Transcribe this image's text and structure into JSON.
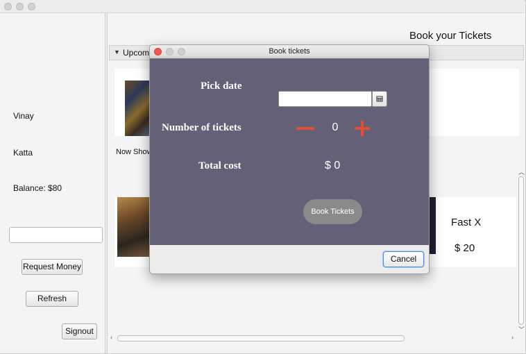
{
  "sidebar": {
    "first_name": "Vinay",
    "last_name": "Katta",
    "balance": "Balance: $80",
    "amount_input": {
      "value": "",
      "placeholder": ""
    },
    "request_money_label": "Request Money",
    "refresh_label": "Refresh",
    "signout_label": "Signout"
  },
  "main": {
    "heading": "Book your Tickets",
    "upcoming_label": "Upcomin",
    "now_showing_label": "Now Show",
    "movie": {
      "title": "Fast X",
      "price": "$ 20"
    }
  },
  "dialog": {
    "title": "Book tickets",
    "pick_date_label": "Pick date",
    "date_input": {
      "value": "",
      "placeholder": ""
    },
    "tickets_label": "Number of tickets",
    "ticket_count": "0",
    "total_cost_label": "Total cost",
    "total_cost_value": "$ 0",
    "book_label": "Book Tickets",
    "cancel_label": "Cancel"
  },
  "colors": {
    "dialog_body": "#646078",
    "stepper_accent": "#e2512f",
    "close_light": "#ee5a52"
  },
  "icons": [
    "calendar-icon",
    "minus-icon",
    "plus-icon",
    "collapse-arrow-icon",
    "scroll-left-icon",
    "scroll-right-icon",
    "scroll-up-icon",
    "scroll-down-icon"
  ]
}
